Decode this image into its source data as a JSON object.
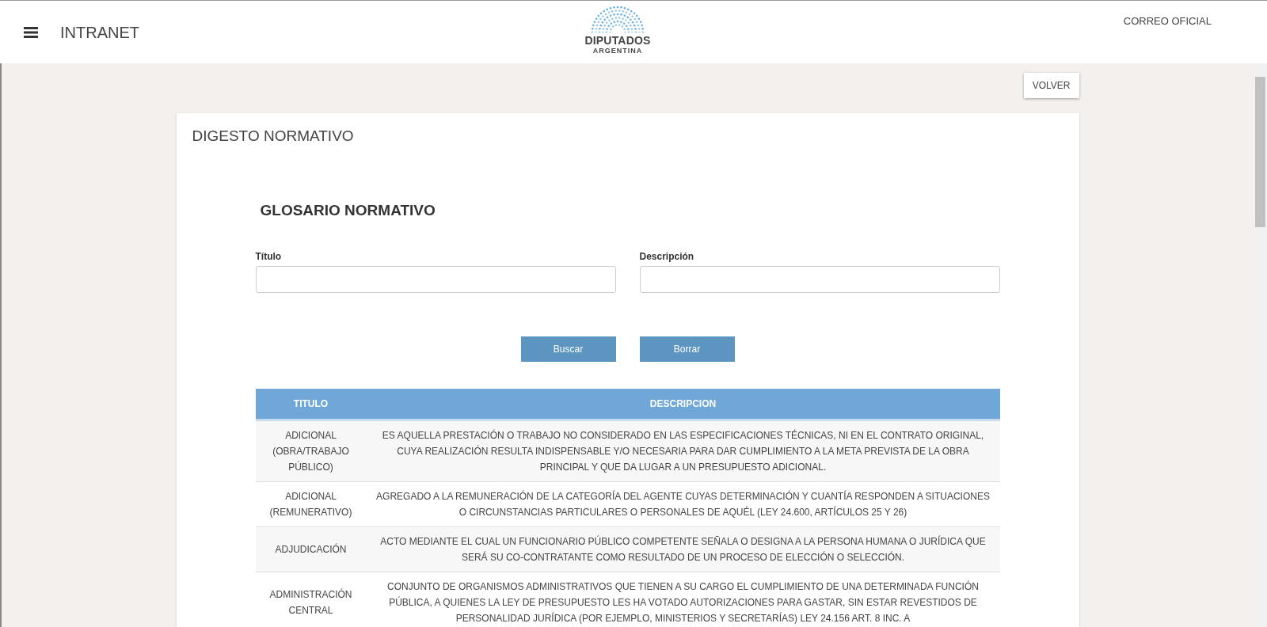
{
  "header": {
    "title": "INTRANET",
    "logo": {
      "name": "DIPUTADOS",
      "subtitle": "ARGENTINA"
    },
    "link": "CORREO OFICIAL"
  },
  "back_button": "VOLVER",
  "card": {
    "title": "DIGESTO NORMATIVO",
    "section_title": "GLOSARIO NORMATIVO",
    "fields": [
      {
        "label": "Título"
      },
      {
        "label": "Descripción"
      }
    ],
    "buttons": [
      "Buscar",
      "Borrar"
    ],
    "table": {
      "columns": [
        "TITULO",
        "DESCRIPCION"
      ],
      "rows": [
        {
          "title": "ADICIONAL (OBRA/TRABAJO PÚBLICO)",
          "description": "ES AQUELLA PRESTACIÓN O TRABAJO NO CONSIDERADO EN LAS ESPECIFICACIONES TÉCNICAS, NI EN EL CONTRATO ORIGINAL, CUYA REALIZACIÓN RESULTA INDISPENSABLE Y/O NECESARIA PARA DAR CUMPLIMIENTO A LA META PREVISTA DE LA OBRA PRINCIPAL Y QUE DA LUGAR A UN PRESUPUESTO ADICIONAL."
        },
        {
          "title": "ADICIONAL (REMUNERATIVO)",
          "description": "AGREGADO A LA REMUNERACIÓN DE LA CATEGORÍA DEL AGENTE CUYAS DETERMINACIÓN Y CUANTÍA RESPONDEN A SITUACIONES O CIRCUNSTANCIAS PARTICULARES O PERSONALES DE AQUÉL (LEY 24.600, ARTÍCULOS 25 Y 26)"
        },
        {
          "title": "ADJUDICACIÓN",
          "description": "ACTO MEDIANTE EL CUAL UN FUNCIONARIO PÚBLICO COMPETENTE SEÑALA O DESIGNA A LA PERSONA HUMANA O JURÍDICA QUE SERÁ SU CO-CONTRATANTE COMO RESULTADO DE UN PROCESO DE ELECCIÓN O SELECCIÓN."
        },
        {
          "title": "ADMINISTRACIÓN CENTRAL",
          "description": "CONJUNTO DE ORGANISMOS ADMINISTRATIVOS QUE TIENEN A SU CARGO EL CUMPLIMIENTO DE UNA DETERMINADA FUNCIÓN PÚBLICA, A QUIENES LA LEY DE PRESUPUESTO LES HA VOTADO AUTORIZACIONES PARA GASTAR, SIN ESTAR REVESTIDOS DE PERSONALIDAD JURÍDICA (POR EJEMPLO, MINISTERIOS Y SECRETARÍAS) LEY 24.156 ART. 8 INC. A"
        }
      ]
    }
  }
}
